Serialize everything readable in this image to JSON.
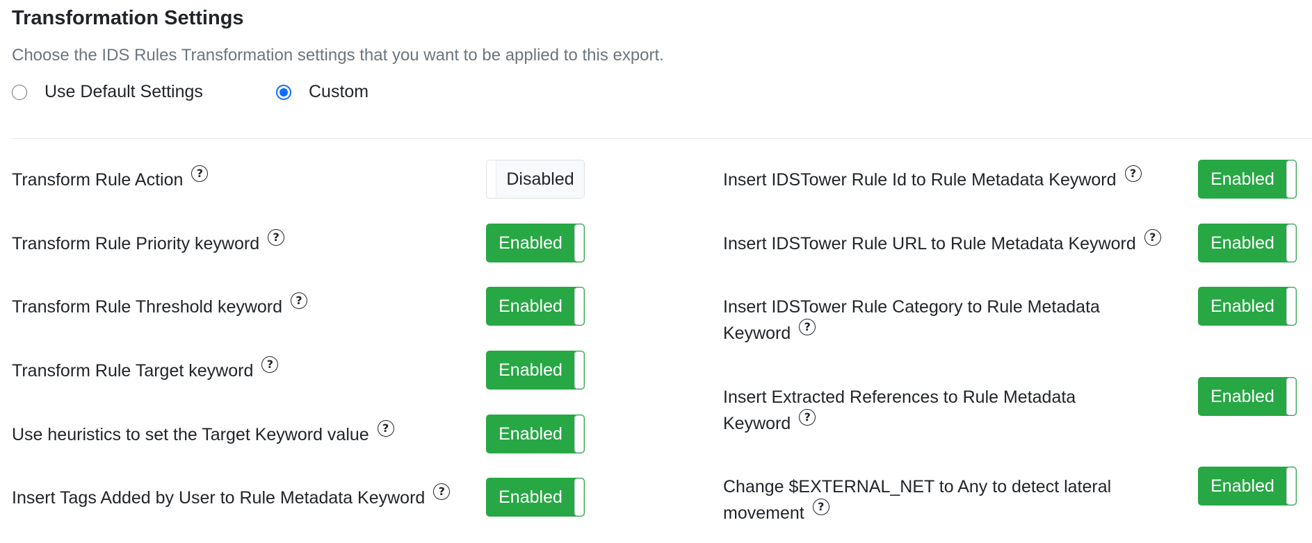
{
  "header": {
    "title": "Transformation Settings",
    "subtitle": "Choose the IDS Rules Transformation settings that you want to be applied to this export."
  },
  "mode": {
    "options": [
      {
        "label": "Use Default Settings",
        "checked": false
      },
      {
        "label": "Custom",
        "checked": true
      }
    ]
  },
  "help_glyph": "?",
  "settings_left": [
    {
      "label": "Transform Rule Action",
      "state": "Disabled"
    },
    {
      "label": "Transform Rule Priority keyword",
      "state": "Enabled"
    },
    {
      "label": "Transform Rule Threshold keyword",
      "state": "Enabled"
    },
    {
      "label": "Transform Rule Target keyword",
      "state": "Enabled"
    },
    {
      "label": "Use heuristics to set the Target Keyword value",
      "state": "Enabled"
    },
    {
      "label": "Insert Tags Added by User to Rule Metadata Keyword",
      "state": "Enabled"
    }
  ],
  "settings_right": [
    {
      "label": "Insert IDSTower Rule Id to Rule Metadata Keyword",
      "state": "Enabled"
    },
    {
      "label": "Insert IDSTower Rule URL to Rule Metadata Keyword",
      "state": "Enabled"
    },
    {
      "label": "Insert IDSTower Rule Category to Rule Metadata Keyword",
      "state": "Enabled"
    },
    {
      "label": "Insert Extracted References to Rule Metadata Keyword",
      "state": "Enabled"
    },
    {
      "label": "Change $EXTERNAL_NET to Any to detect lateral movement",
      "state": "Enabled"
    }
  ],
  "colors": {
    "enabled": "#28a745",
    "disabled_bg": "#f8f9fa",
    "radio_checked": "#0d6efd"
  }
}
